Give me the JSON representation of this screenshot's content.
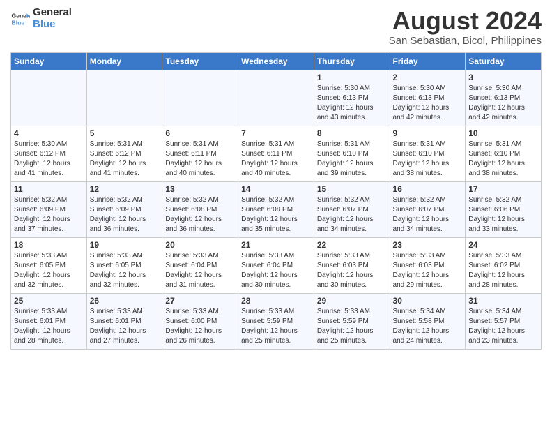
{
  "header": {
    "logo_line1": "General",
    "logo_line2": "Blue",
    "month_title": "August 2024",
    "subtitle": "San Sebastian, Bicol, Philippines"
  },
  "weekdays": [
    "Sunday",
    "Monday",
    "Tuesday",
    "Wednesday",
    "Thursday",
    "Friday",
    "Saturday"
  ],
  "weeks": [
    [
      {
        "day": "",
        "sunrise": "",
        "sunset": "",
        "daylight": ""
      },
      {
        "day": "",
        "sunrise": "",
        "sunset": "",
        "daylight": ""
      },
      {
        "day": "",
        "sunrise": "",
        "sunset": "",
        "daylight": ""
      },
      {
        "day": "",
        "sunrise": "",
        "sunset": "",
        "daylight": ""
      },
      {
        "day": "1",
        "sunrise": "5:30 AM",
        "sunset": "6:13 PM",
        "daylight": "12 hours and 43 minutes."
      },
      {
        "day": "2",
        "sunrise": "5:30 AM",
        "sunset": "6:13 PM",
        "daylight": "12 hours and 42 minutes."
      },
      {
        "day": "3",
        "sunrise": "5:30 AM",
        "sunset": "6:13 PM",
        "daylight": "12 hours and 42 minutes."
      }
    ],
    [
      {
        "day": "4",
        "sunrise": "5:30 AM",
        "sunset": "6:12 PM",
        "daylight": "12 hours and 41 minutes."
      },
      {
        "day": "5",
        "sunrise": "5:31 AM",
        "sunset": "6:12 PM",
        "daylight": "12 hours and 41 minutes."
      },
      {
        "day": "6",
        "sunrise": "5:31 AM",
        "sunset": "6:11 PM",
        "daylight": "12 hours and 40 minutes."
      },
      {
        "day": "7",
        "sunrise": "5:31 AM",
        "sunset": "6:11 PM",
        "daylight": "12 hours and 40 minutes."
      },
      {
        "day": "8",
        "sunrise": "5:31 AM",
        "sunset": "6:10 PM",
        "daylight": "12 hours and 39 minutes."
      },
      {
        "day": "9",
        "sunrise": "5:31 AM",
        "sunset": "6:10 PM",
        "daylight": "12 hours and 38 minutes."
      },
      {
        "day": "10",
        "sunrise": "5:31 AM",
        "sunset": "6:10 PM",
        "daylight": "12 hours and 38 minutes."
      }
    ],
    [
      {
        "day": "11",
        "sunrise": "5:32 AM",
        "sunset": "6:09 PM",
        "daylight": "12 hours and 37 minutes."
      },
      {
        "day": "12",
        "sunrise": "5:32 AM",
        "sunset": "6:09 PM",
        "daylight": "12 hours and 36 minutes."
      },
      {
        "day": "13",
        "sunrise": "5:32 AM",
        "sunset": "6:08 PM",
        "daylight": "12 hours and 36 minutes."
      },
      {
        "day": "14",
        "sunrise": "5:32 AM",
        "sunset": "6:08 PM",
        "daylight": "12 hours and 35 minutes."
      },
      {
        "day": "15",
        "sunrise": "5:32 AM",
        "sunset": "6:07 PM",
        "daylight": "12 hours and 34 minutes."
      },
      {
        "day": "16",
        "sunrise": "5:32 AM",
        "sunset": "6:07 PM",
        "daylight": "12 hours and 34 minutes."
      },
      {
        "day": "17",
        "sunrise": "5:32 AM",
        "sunset": "6:06 PM",
        "daylight": "12 hours and 33 minutes."
      }
    ],
    [
      {
        "day": "18",
        "sunrise": "5:33 AM",
        "sunset": "6:05 PM",
        "daylight": "12 hours and 32 minutes."
      },
      {
        "day": "19",
        "sunrise": "5:33 AM",
        "sunset": "6:05 PM",
        "daylight": "12 hours and 32 minutes."
      },
      {
        "day": "20",
        "sunrise": "5:33 AM",
        "sunset": "6:04 PM",
        "daylight": "12 hours and 31 minutes."
      },
      {
        "day": "21",
        "sunrise": "5:33 AM",
        "sunset": "6:04 PM",
        "daylight": "12 hours and 30 minutes."
      },
      {
        "day": "22",
        "sunrise": "5:33 AM",
        "sunset": "6:03 PM",
        "daylight": "12 hours and 30 minutes."
      },
      {
        "day": "23",
        "sunrise": "5:33 AM",
        "sunset": "6:03 PM",
        "daylight": "12 hours and 29 minutes."
      },
      {
        "day": "24",
        "sunrise": "5:33 AM",
        "sunset": "6:02 PM",
        "daylight": "12 hours and 28 minutes."
      }
    ],
    [
      {
        "day": "25",
        "sunrise": "5:33 AM",
        "sunset": "6:01 PM",
        "daylight": "12 hours and 28 minutes."
      },
      {
        "day": "26",
        "sunrise": "5:33 AM",
        "sunset": "6:01 PM",
        "daylight": "12 hours and 27 minutes."
      },
      {
        "day": "27",
        "sunrise": "5:33 AM",
        "sunset": "6:00 PM",
        "daylight": "12 hours and 26 minutes."
      },
      {
        "day": "28",
        "sunrise": "5:33 AM",
        "sunset": "5:59 PM",
        "daylight": "12 hours and 25 minutes."
      },
      {
        "day": "29",
        "sunrise": "5:33 AM",
        "sunset": "5:59 PM",
        "daylight": "12 hours and 25 minutes."
      },
      {
        "day": "30",
        "sunrise": "5:34 AM",
        "sunset": "5:58 PM",
        "daylight": "12 hours and 24 minutes."
      },
      {
        "day": "31",
        "sunrise": "5:34 AM",
        "sunset": "5:57 PM",
        "daylight": "12 hours and 23 minutes."
      }
    ]
  ]
}
